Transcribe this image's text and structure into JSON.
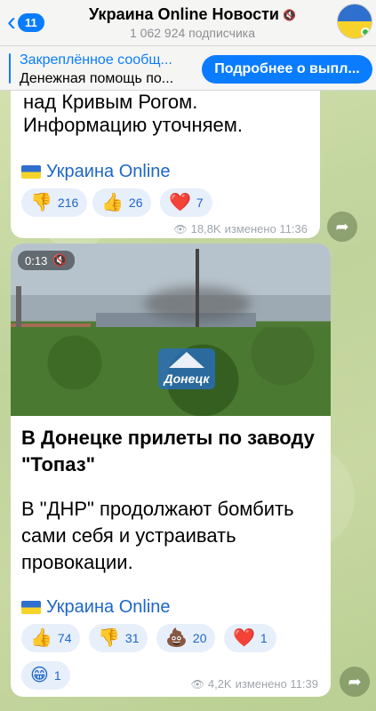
{
  "header": {
    "back_count": "11",
    "channel_title": "Украина Online Новости",
    "subscribers": "1 062 924 подписчика"
  },
  "pinned": {
    "title": "Закреплённое сообщ...",
    "text": "Денежная помощь по...",
    "button": "Подробнее о выпл..."
  },
  "message1": {
    "text_line1": "над Кривым Рогом.",
    "text_line2": "Информацию уточняем.",
    "signature": "Украина Online",
    "reactions": [
      {
        "emoji": "👎",
        "count": "216"
      },
      {
        "emoji": "👍",
        "count": "26"
      },
      {
        "emoji": "❤️",
        "count": "7"
      }
    ],
    "views": "18,8K",
    "edited": "изменено 11:36"
  },
  "message2": {
    "video_duration": "0:13",
    "watermark": "Донецк",
    "title_line1": "В Донецке прилеты по заводу",
    "title_line2": "\"Топаз\"",
    "text_line1": "В \"ДНР\" продолжают бомбить",
    "text_line2": "сами себя и устраивать",
    "text_line3": "провокации.",
    "signature": "Украина Online",
    "reactions": [
      {
        "emoji": "👍",
        "count": "74"
      },
      {
        "emoji": "👎",
        "count": "31"
      },
      {
        "emoji": "💩",
        "count": "20"
      },
      {
        "emoji": "❤️",
        "count": "1"
      },
      {
        "emoji": "😁",
        "count": "1"
      }
    ],
    "views": "4,2K",
    "edited": "изменено 11:39"
  },
  "colors": {
    "accent": "#0a7cff",
    "link": "#1d66c9",
    "reaction_bg": "#e7effb"
  }
}
